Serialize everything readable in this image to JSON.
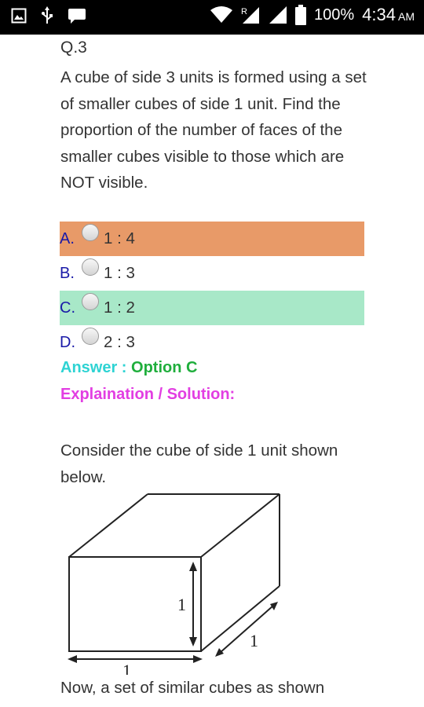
{
  "status_bar": {
    "battery": "100%",
    "time": "4:34",
    "ampm": "AM",
    "icons": [
      "gallery-icon",
      "usb-icon",
      "chat-icon",
      "wifi-icon",
      "signal-r-icon",
      "signal-icon",
      "battery-icon"
    ]
  },
  "question": {
    "number": "Q.3",
    "text": "A cube of side 3 units is formed using a set of smaller cubes of side 1 unit. Find the proportion of the number of faces of the smaller cubes visible to those which are NOT visible."
  },
  "options": [
    {
      "letter": "A.",
      "text": "1 : 4",
      "highlight": "#e89a68"
    },
    {
      "letter": "B.",
      "text": "1 : 3",
      "highlight": ""
    },
    {
      "letter": "C.",
      "text": "1 : 2",
      "highlight": "#a8e8c8"
    },
    {
      "letter": "D.",
      "text": "2 : 3",
      "highlight": ""
    }
  ],
  "answer": {
    "label": "Answer :",
    "value": "Option C"
  },
  "explanation_label": "Explaination / Solution:",
  "solution_text": "Consider the cube of side 1 unit shown below.",
  "figure": {
    "label_height": "1",
    "label_depth": "1",
    "label_width": "1"
  },
  "continuation_text": "Now, a set of similar cubes as shown"
}
